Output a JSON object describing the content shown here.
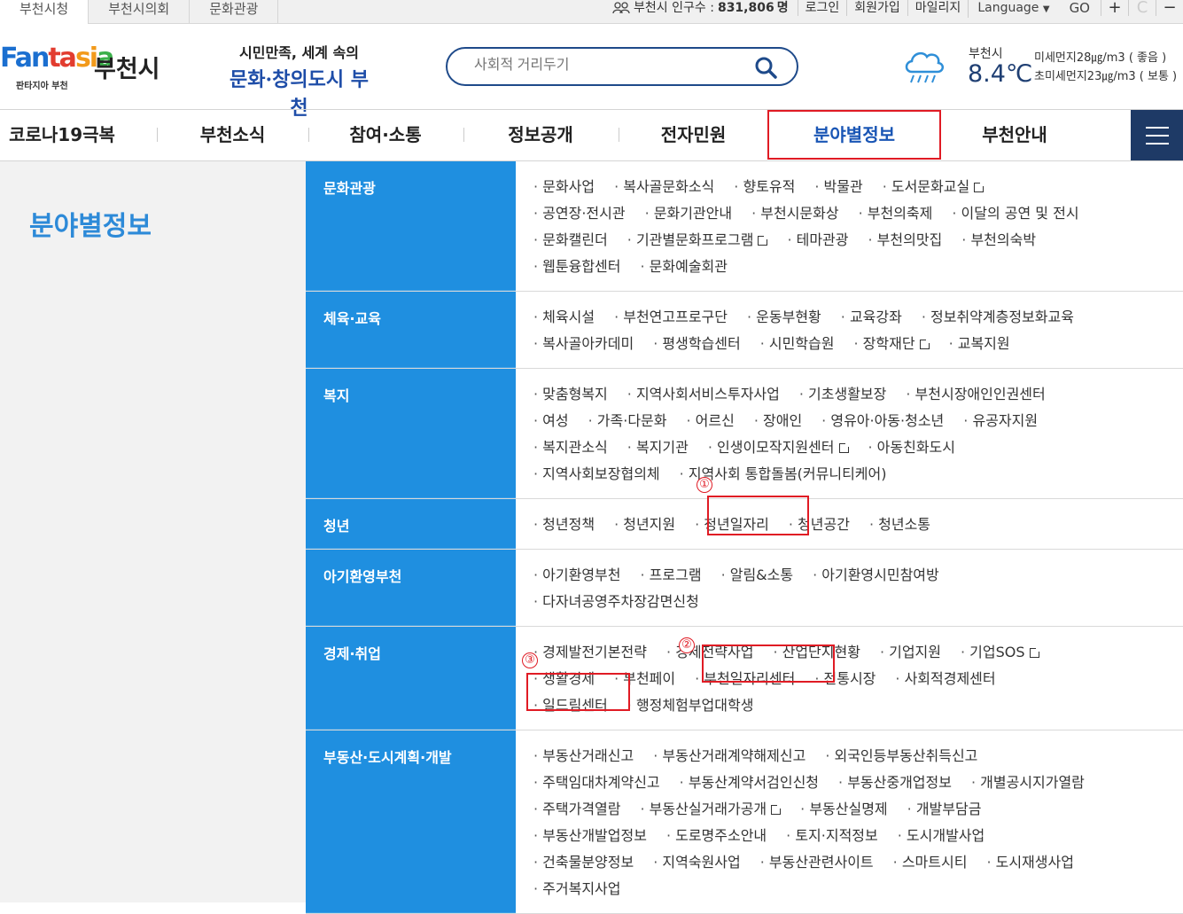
{
  "top_tabs": [
    "부천시청",
    "부천시의회",
    "문화관광"
  ],
  "population": {
    "label": "부천시 인구수 :",
    "value": "831,806",
    "unit": "명"
  },
  "top_links": [
    "로그인",
    "회원가입",
    "마일리지"
  ],
  "language": "Language",
  "go": "GO",
  "controls": [
    "+",
    "C",
    "−"
  ],
  "logo": {
    "brand": "Fantasia",
    "city": "부천시",
    "sub": "판타지아 부천"
  },
  "slogan": {
    "line1": "시민만족, 세계 속의",
    "line2": "문화·창의도시 부천"
  },
  "search": {
    "placeholder": "사회적 거리두기"
  },
  "weather": {
    "city": "부천시",
    "temp": "8.4℃",
    "pm10": "미세먼지28㎍/m3 ( 좋음 )",
    "pm25": "초미세먼지23㎍/m3 ( 보통 )"
  },
  "gnb": [
    "코로나19극복",
    "부천소식",
    "참여·소통",
    "정보공개",
    "전자민원",
    "분야별정보",
    "부천안내"
  ],
  "page_title": "분야별정보",
  "categories": [
    {
      "name": "문화관광",
      "rows": [
        [
          "문화사업",
          "복사골문화소식",
          "향토유적",
          "박물관",
          "도서문화교실"
        ],
        [
          "공연장·전시관",
          "문화기관안내",
          "부천시문화상",
          "부천의축제",
          "이달의 공연 및 전시"
        ],
        [
          "문화캘린더",
          "기관별문화프로그램",
          "테마관광",
          "부천의맛집",
          "부천의숙박"
        ],
        [
          "웹툰융합센터",
          "문화예술회관"
        ]
      ]
    },
    {
      "name": "체육·교육",
      "rows": [
        [
          "체육시설",
          "부천연고프로구단",
          "운동부현황",
          "교육강좌",
          "정보취약계층정보화교육"
        ],
        [
          "복사골아카데미",
          "평생학습센터",
          "시민학습원",
          "장학재단",
          "교복지원"
        ]
      ]
    },
    {
      "name": "복지",
      "rows": [
        [
          "맞춤형복지",
          "지역사회서비스투자사업",
          "기초생활보장",
          "부천시장애인인권센터"
        ],
        [
          "여성",
          "가족·다문화",
          "어르신",
          "장애인",
          "영유아·아동·청소년",
          "유공자지원"
        ],
        [
          "복지관소식",
          "복지기관",
          "인생이모작지원센터",
          "아동친화도시"
        ],
        [
          "지역사회보장협의체",
          "지역사회 통합돌봄(커뮤니티케어)"
        ]
      ]
    },
    {
      "name": "청년",
      "rows": [
        [
          "청년정책",
          "청년지원",
          "청년일자리",
          "청년공간",
          "청년소통"
        ]
      ]
    },
    {
      "name": "아기환영부천",
      "rows": [
        [
          "아기환영부천",
          "프로그램",
          "알림&소통",
          "아기환영시민참여방"
        ],
        [
          "다자녀공영주차장감면신청"
        ]
      ]
    },
    {
      "name": "경제·취업",
      "rows": [
        [
          "경제발전기본전략",
          "경제전략사업",
          "산업단지현황",
          "기업지원",
          "기업SOS"
        ],
        [
          "생활경제",
          "부천페이",
          "부천일자리센터",
          "전통시장",
          "사회적경제센터"
        ],
        [
          "일드림센터",
          "행정체험부업대학생"
        ]
      ]
    },
    {
      "name": "부동산·도시계획·개발",
      "rows": [
        [
          "부동산거래신고",
          "부동산거래계약해제신고",
          "외국인등부동산취득신고"
        ],
        [
          "주택임대차계약신고",
          "부동산계약서검인신청",
          "부동산중개업정보",
          "개별공시지가열람"
        ],
        [
          "주택가격열람",
          "부동산실거래가공개",
          "부동산실명제",
          "개발부담금"
        ],
        [
          "부동산개발업정보",
          "도로명주소안내",
          "토지·지적정보",
          "도시개발사업"
        ],
        [
          "건축물분양정보",
          "지역숙원사업",
          "부동산관련사이트",
          "스마트시티",
          "도시재생사업"
        ],
        [
          "주거복지사업"
        ]
      ]
    }
  ],
  "external_links": [
    "도서문화교실",
    "기관별문화프로그램",
    "장학재단",
    "인생이모작지원센터",
    "기업SOS",
    "부동산실거래가공개"
  ],
  "annotations": [
    "①",
    "②",
    "③"
  ]
}
